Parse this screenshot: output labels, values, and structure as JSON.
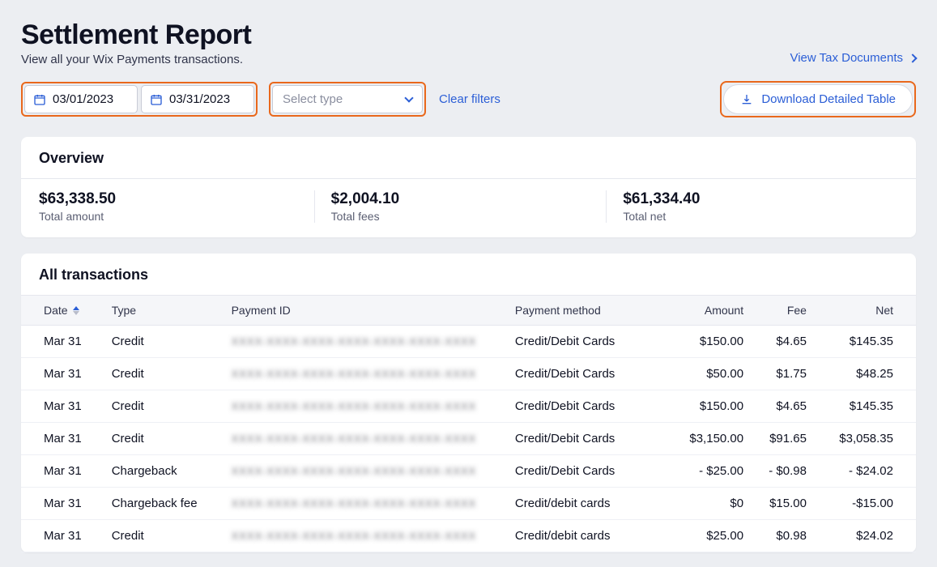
{
  "header": {
    "title": "Settlement Report",
    "subtitle": "View all your Wix Payments transactions.",
    "tax_link": "View Tax Documents"
  },
  "filters": {
    "date_from": "03/01/2023",
    "date_to": "03/31/2023",
    "type_placeholder": "Select type",
    "clear": "Clear filters",
    "download": "Download Detailed Table"
  },
  "overview": {
    "title": "Overview",
    "total_amount": {
      "value": "$63,338.50",
      "label": "Total amount"
    },
    "total_fees": {
      "value": "$2,004.10",
      "label": "Total fees"
    },
    "total_net": {
      "value": "$61,334.40",
      "label": "Total net"
    }
  },
  "transactions": {
    "title": "All transactions",
    "columns": {
      "date": "Date",
      "type": "Type",
      "payment_id": "Payment ID",
      "method": "Payment method",
      "amount": "Amount",
      "fee": "Fee",
      "net": "Net"
    },
    "rows": [
      {
        "date": "Mar 31",
        "type": "Credit",
        "method": "Credit/Debit Cards",
        "amount": "$150.00",
        "fee": "$4.65",
        "net": "$145.35"
      },
      {
        "date": "Mar 31",
        "type": "Credit",
        "method": "Credit/Debit Cards",
        "amount": "$50.00",
        "fee": "$1.75",
        "net": "$48.25"
      },
      {
        "date": "Mar 31",
        "type": "Credit",
        "method": "Credit/Debit Cards",
        "amount": "$150.00",
        "fee": "$4.65",
        "net": "$145.35"
      },
      {
        "date": "Mar 31",
        "type": "Credit",
        "method": "Credit/Debit Cards",
        "amount": "$3,150.00",
        "fee": "$91.65",
        "net": "$3,058.35"
      },
      {
        "date": "Mar 31",
        "type": "Chargeback",
        "method": "Credit/Debit Cards",
        "amount": "- $25.00",
        "fee": "- $0.98",
        "net": "- $24.02"
      },
      {
        "date": "Mar 31",
        "type": "Chargeback fee",
        "method": "Credit/debit cards",
        "amount": "$0",
        "fee": "$15.00",
        "net": "-$15.00"
      },
      {
        "date": "Mar 31",
        "type": "Credit",
        "method": "Credit/debit cards",
        "amount": "$25.00",
        "fee": "$0.98",
        "net": "$24.02"
      }
    ]
  }
}
